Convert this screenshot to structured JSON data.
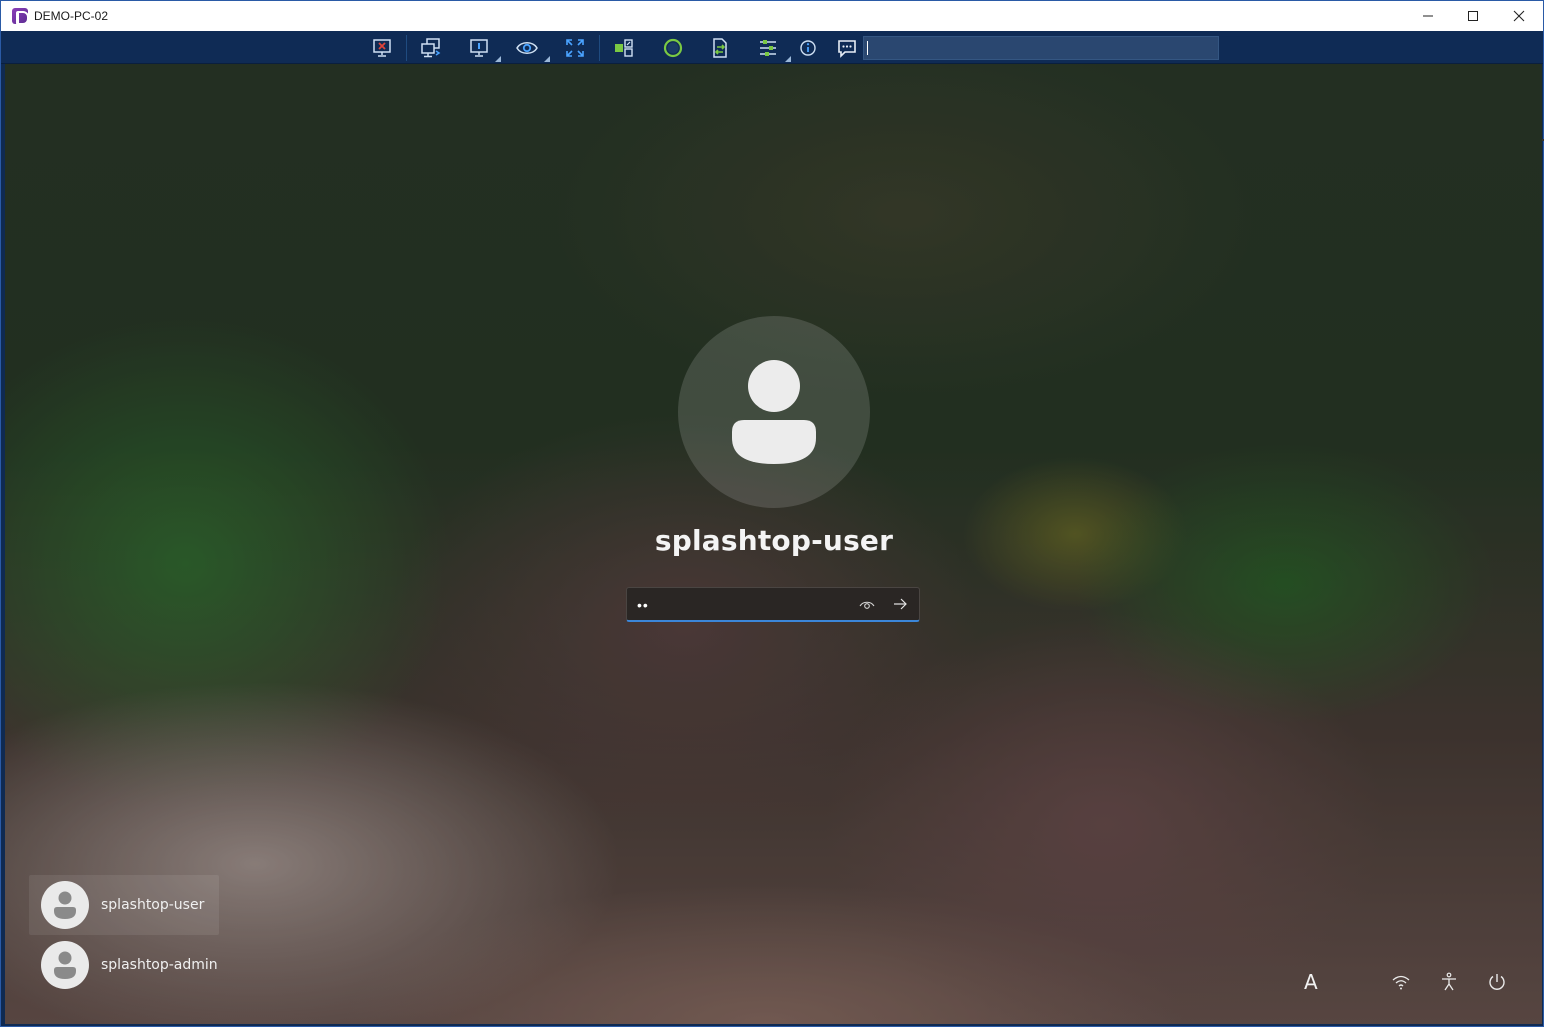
{
  "window": {
    "title": "DEMO-PC-02"
  },
  "toolbar": {
    "buttons": [
      {
        "name": "disconnect-button",
        "icon": "disconnect-icon"
      },
      {
        "name": "switch-monitor-button",
        "icon": "switch-monitor-icon"
      },
      {
        "name": "display-settings-button",
        "icon": "display-icon"
      },
      {
        "name": "view-only-button",
        "icon": "eye-icon"
      },
      {
        "name": "fullscreen-button",
        "icon": "fullscreen-icon"
      },
      {
        "name": "blank-screen-button",
        "icon": "blank-screen-icon"
      },
      {
        "name": "recording-button",
        "icon": "record-icon"
      },
      {
        "name": "file-transfer-button",
        "icon": "file-transfer-icon"
      },
      {
        "name": "settings-button",
        "icon": "settings-list-icon"
      },
      {
        "name": "info-button",
        "icon": "info-icon"
      },
      {
        "name": "chat-button",
        "icon": "chat-icon"
      }
    ],
    "chat_input_value": ""
  },
  "lockscreen": {
    "username": "splashtop-user",
    "password_mask": "••",
    "users": [
      {
        "name": "splashtop-user",
        "selected": true
      },
      {
        "name": "splashtop-admin",
        "selected": false
      }
    ],
    "language_indicator": "A",
    "system_icons": [
      "wifi-icon",
      "accessibility-icon",
      "power-icon"
    ]
  },
  "colors": {
    "titlebar_bg": "#ffffff",
    "toolbar_bg": "#0f2b55",
    "focus_accent": "#3b86d9"
  }
}
